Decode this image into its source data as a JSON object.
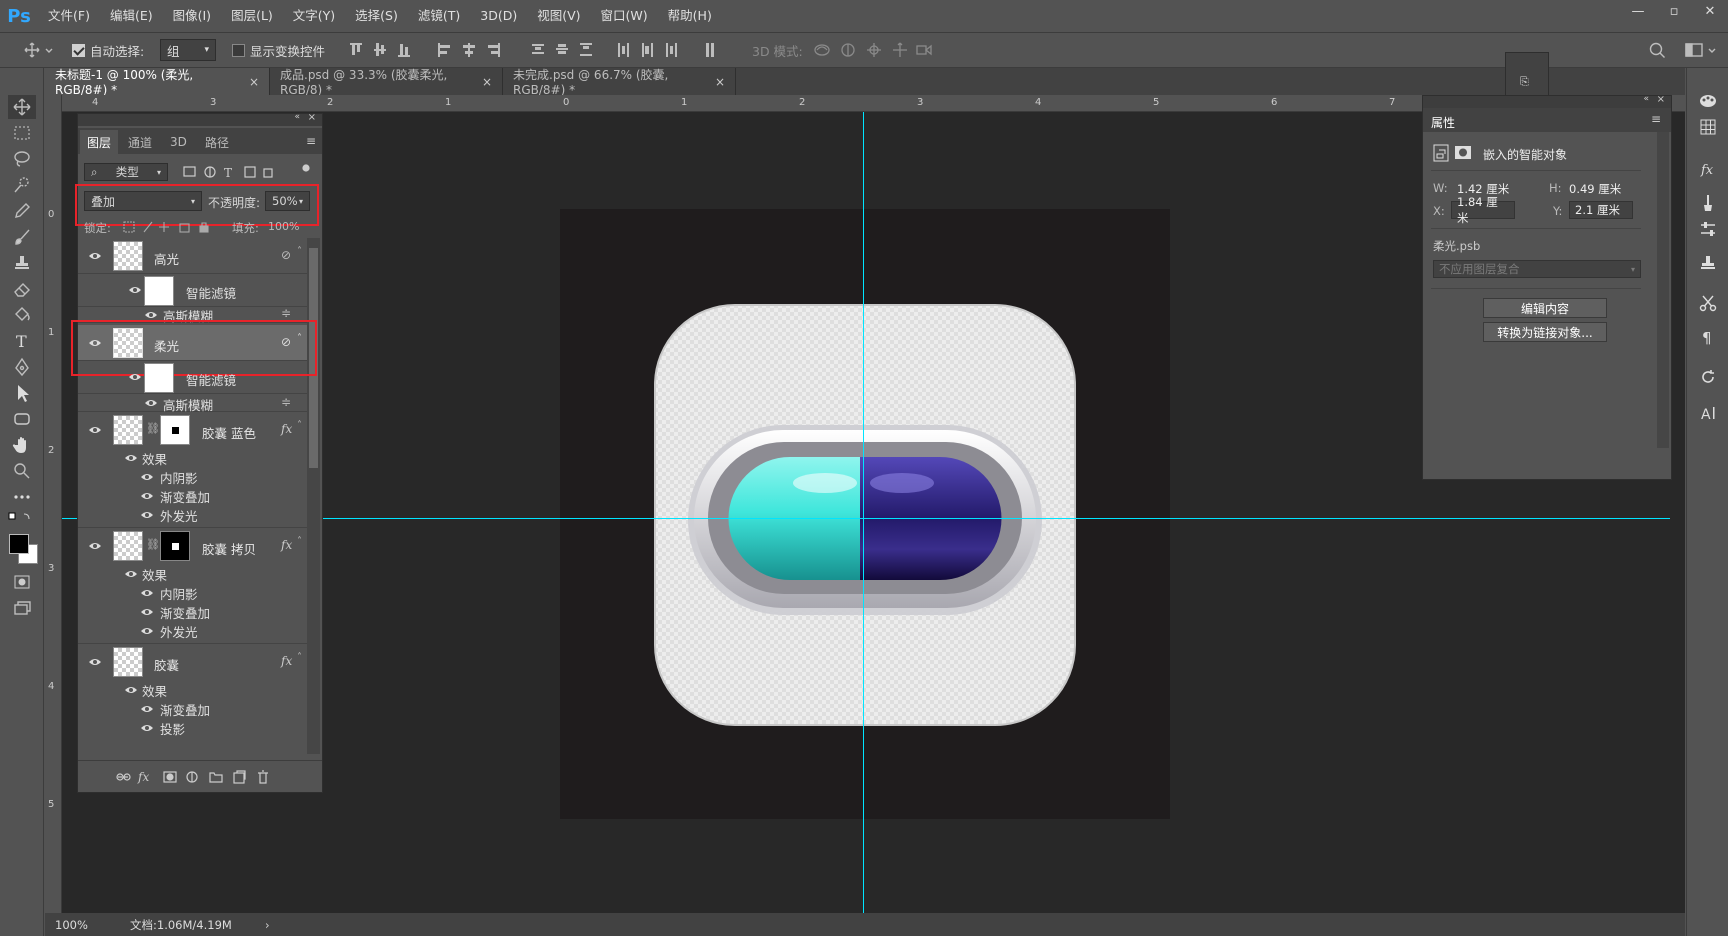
{
  "app": {
    "logo": "Ps"
  },
  "menu": [
    "文件(F)",
    "编辑(E)",
    "图像(I)",
    "图层(L)",
    "文字(Y)",
    "选择(S)",
    "滤镜(T)",
    "3D(D)",
    "视图(V)",
    "窗口(W)",
    "帮助(H)"
  ],
  "options": {
    "auto_select_label": "自动选择:",
    "auto_select_value": "组",
    "show_transform_label": "显示变换控件",
    "mode_3d_label": "3D 模式:"
  },
  "tabs": [
    {
      "label": "未标题-1 @ 100% (柔光, RGB/8#) *"
    },
    {
      "label": "成品.psd @ 33.3% (胶囊柔光, RGB/8) *"
    },
    {
      "label": "未完成.psd @ 66.7% (胶囊, RGB/8#) *"
    }
  ],
  "ruler_h": [
    "4",
    "3",
    "2",
    "1",
    "0",
    "1",
    "2",
    "3",
    "4",
    "5",
    "6",
    "7"
  ],
  "ruler_v": [
    "0",
    "1",
    "2",
    "3",
    "4",
    "5"
  ],
  "status": {
    "zoom": "100%",
    "doc": "文档:1.06M/4.19M"
  },
  "layers_panel": {
    "tabs": [
      "图层",
      "通道",
      "3D",
      "路径"
    ],
    "filter_kind": "类型",
    "blend_mode": "叠加",
    "opacity_label": "不透明度:",
    "opacity_value": "50%",
    "lock_label": "锁定:",
    "fill_label": "填充:",
    "fill_value": "100%",
    "layers": [
      {
        "name": "高光",
        "filter": "智能滤镜",
        "effect": "高斯模糊"
      },
      {
        "name": "柔光",
        "filter": "智能滤镜",
        "effect": "高斯模糊"
      },
      {
        "name": "胶囊 蓝色",
        "effects_label": "效果",
        "effects": [
          "内阴影",
          "渐变叠加",
          "外发光"
        ]
      },
      {
        "name": "胶囊 拷贝",
        "effects_label": "效果",
        "effects": [
          "内阴影",
          "渐变叠加",
          "外发光"
        ]
      },
      {
        "name": "胶囊",
        "effects_label": "效果",
        "effects": [
          "渐变叠加",
          "投影"
        ]
      }
    ]
  },
  "properties": {
    "title": "属性",
    "header": "嵌入的智能对象",
    "w_label": "W:",
    "w_value": "1.42 厘米",
    "h_label": "H:",
    "h_value": "0.49 厘米",
    "x_label": "X:",
    "x_value": "1.84 厘米",
    "y_label": "Y:",
    "y_value": "2.1 厘米",
    "file": "柔光.psb",
    "comp_placeholder": "不应用图层复合",
    "edit_btn": "编辑内容",
    "convert_btn": "转换为链接对象..."
  },
  "colors": {
    "accent": "#31a8ff",
    "highlight_box": "#e8232a",
    "guide": "#00e5ff",
    "capsule_left": "#3ee0d4",
    "capsule_right": "#2a1f6e"
  }
}
